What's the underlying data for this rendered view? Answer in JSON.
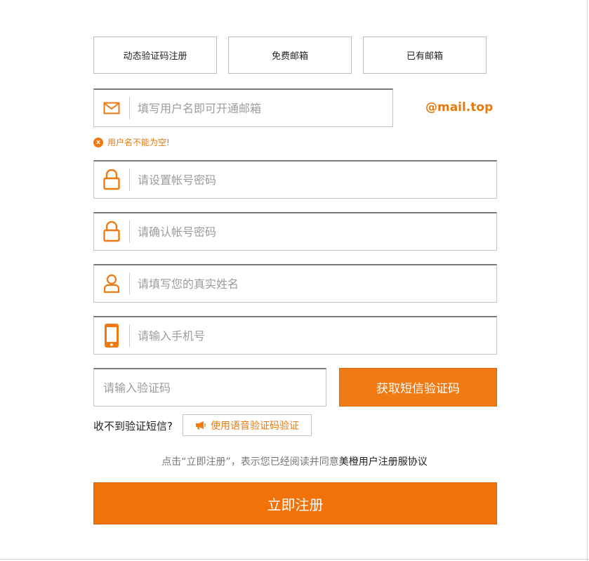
{
  "tabs": [
    {
      "label": "动态验证码注册"
    },
    {
      "label": "免费邮箱"
    },
    {
      "label": "已有邮箱"
    }
  ],
  "username": {
    "placeholder": "填写用户名即可开通邮箱",
    "value": "",
    "icon": "mail-icon"
  },
  "domain_suffix": "@mail.top",
  "error": {
    "icon": "x",
    "message": "用户名不能为空!"
  },
  "password": {
    "placeholder": "请设置帐号密码",
    "value": "",
    "icon": "lock-icon"
  },
  "confirm_password": {
    "placeholder": "请确认帐号密码",
    "value": "",
    "icon": "lock-icon"
  },
  "real_name": {
    "placeholder": "请填写您的真实姓名",
    "value": "",
    "icon": "user-icon"
  },
  "phone": {
    "placeholder": "请输入手机号",
    "value": "",
    "icon": "phone-icon"
  },
  "sms_code": {
    "placeholder": "请输入验证码",
    "value": ""
  },
  "sms_button": "获取短信验证码",
  "no_sms_text": "收不到验证短信?",
  "voice_button": "使用语音验证码验证",
  "agreement": {
    "prefix": "点击“立即注册”，表示您已经阅读并同意",
    "link": "美橙用户注册服协议"
  },
  "submit_button": "立即注册",
  "colors": {
    "accent": "#f2720a",
    "accent_text": "#e57a10",
    "border": "#c4c4c4"
  }
}
